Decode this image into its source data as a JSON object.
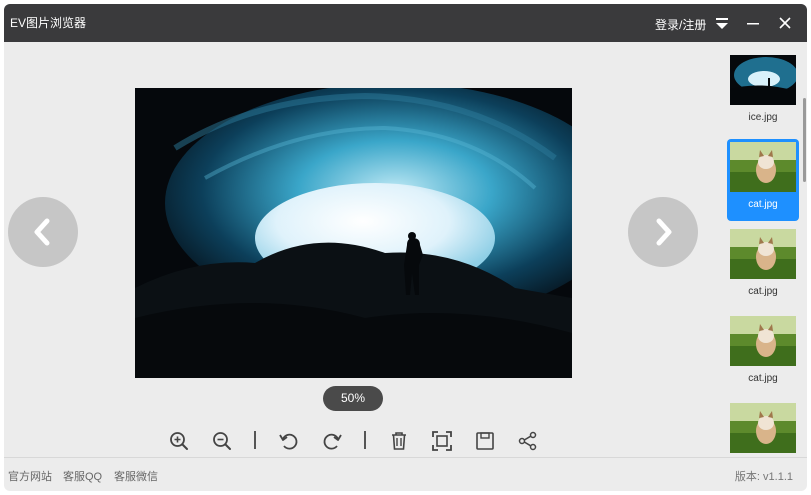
{
  "app": {
    "title": "EV图片浏览器"
  },
  "titlebar": {
    "login_label": "登录/注册"
  },
  "viewer": {
    "zoom": "50%"
  },
  "thumbnails": [
    {
      "filename": "ice.jpg",
      "selected": false
    },
    {
      "filename": "cat.jpg",
      "selected": true
    },
    {
      "filename": "cat.jpg",
      "selected": false
    },
    {
      "filename": "cat.jpg",
      "selected": false
    },
    {
      "filename": "",
      "selected": false
    }
  ],
  "footer": {
    "links": [
      "官方网站",
      "客服QQ",
      "客服微信"
    ],
    "version": "版本: v1.1.1"
  },
  "icons": {
    "toolbar": [
      "zoom-in-icon",
      "zoom-out-icon",
      "rotate-left-icon",
      "rotate-right-icon",
      "delete-icon",
      "fit-screen-icon",
      "save-icon",
      "share-icon"
    ]
  },
  "colors": {
    "titlebar": "#3a3a3c",
    "background": "#ececec",
    "selection": "#1e90ff",
    "zoom_pill": "#4a4a4a"
  }
}
